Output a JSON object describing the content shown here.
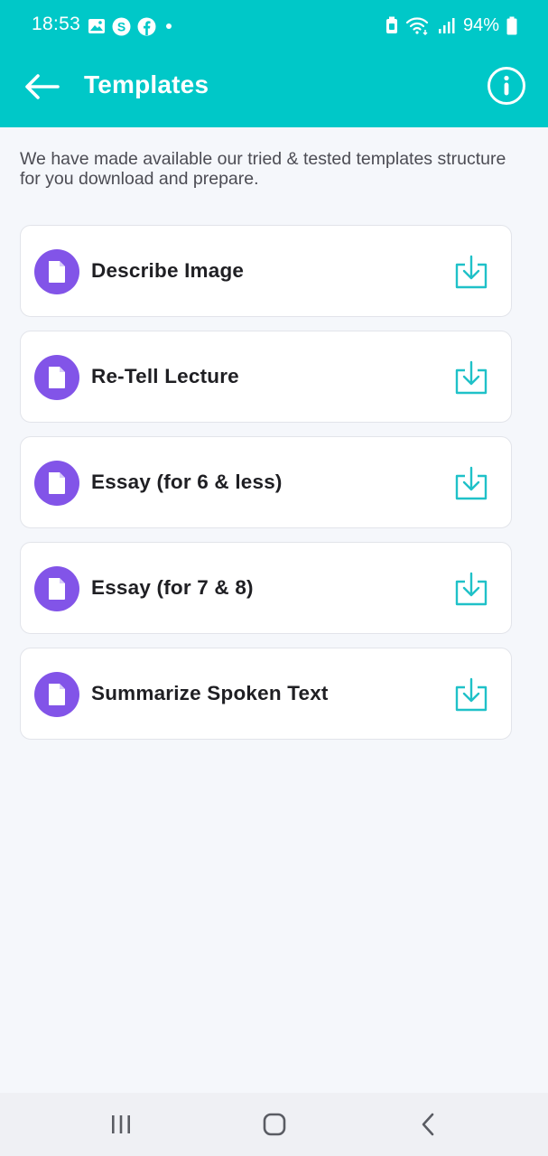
{
  "status_bar": {
    "time": "18:53",
    "battery": "94%",
    "left_icons": [
      "gallery-icon",
      "skype-icon",
      "facebook-icon",
      "dot-icon"
    ],
    "right_icons": [
      "battery-saver-icon",
      "wifi-icon",
      "signal-icon",
      "battery-icon"
    ]
  },
  "app_bar": {
    "title": "Templates",
    "back_icon": "arrow-left-icon",
    "info_icon": "info-circle-icon"
  },
  "intro_text": "We have made available our tried & tested templates structure for you download and prepare.",
  "templates": [
    {
      "label": "Describe Image",
      "icon": "document-icon",
      "action_icon": "download-icon"
    },
    {
      "label": "Re-Tell Lecture",
      "icon": "document-icon",
      "action_icon": "download-icon"
    },
    {
      "label": "Essay (for 6 & less)",
      "icon": "document-icon",
      "action_icon": "download-icon"
    },
    {
      "label": "Essay (for 7 & 8)",
      "icon": "document-icon",
      "action_icon": "download-icon"
    },
    {
      "label": "Summarize Spoken Text",
      "icon": "document-icon",
      "action_icon": "download-icon"
    }
  ],
  "nav_bar": {
    "buttons": [
      "recent-apps-icon",
      "home-icon",
      "back-icon"
    ]
  },
  "colors": {
    "header": "#00c8c8",
    "accent_purple": "#8254e8",
    "download_icon": "#1fc1c8",
    "background": "#f5f7fb"
  }
}
